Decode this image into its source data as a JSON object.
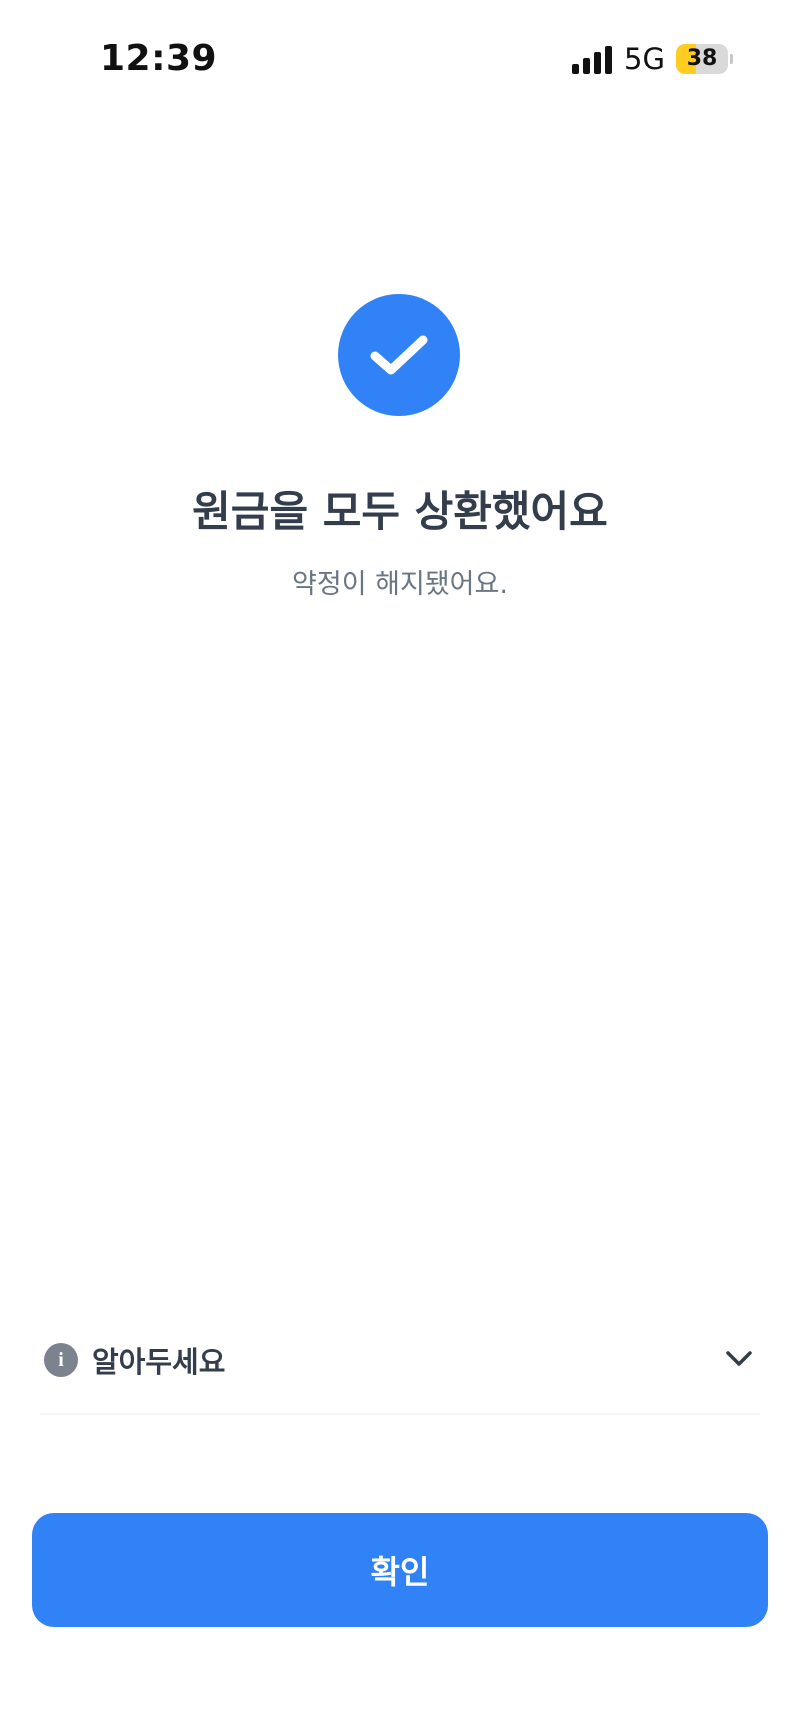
{
  "status_bar": {
    "time": "12:39",
    "network": "5G",
    "battery_level": "38",
    "battery_fraction": 0.38,
    "battery_color": "#ffcc1f"
  },
  "success": {
    "icon": "check-icon",
    "title": "원금을 모두 상환했어요",
    "subtitle": "약정이 해지됐어요."
  },
  "notice": {
    "icon": "info-icon",
    "label": "알아두세요",
    "toggle_icon": "chevron-down-icon"
  },
  "confirm_button": {
    "label": "확인"
  },
  "colors": {
    "accent": "#3182f6",
    "title_text": "#333d4b",
    "sub_text": "#6b7684"
  }
}
